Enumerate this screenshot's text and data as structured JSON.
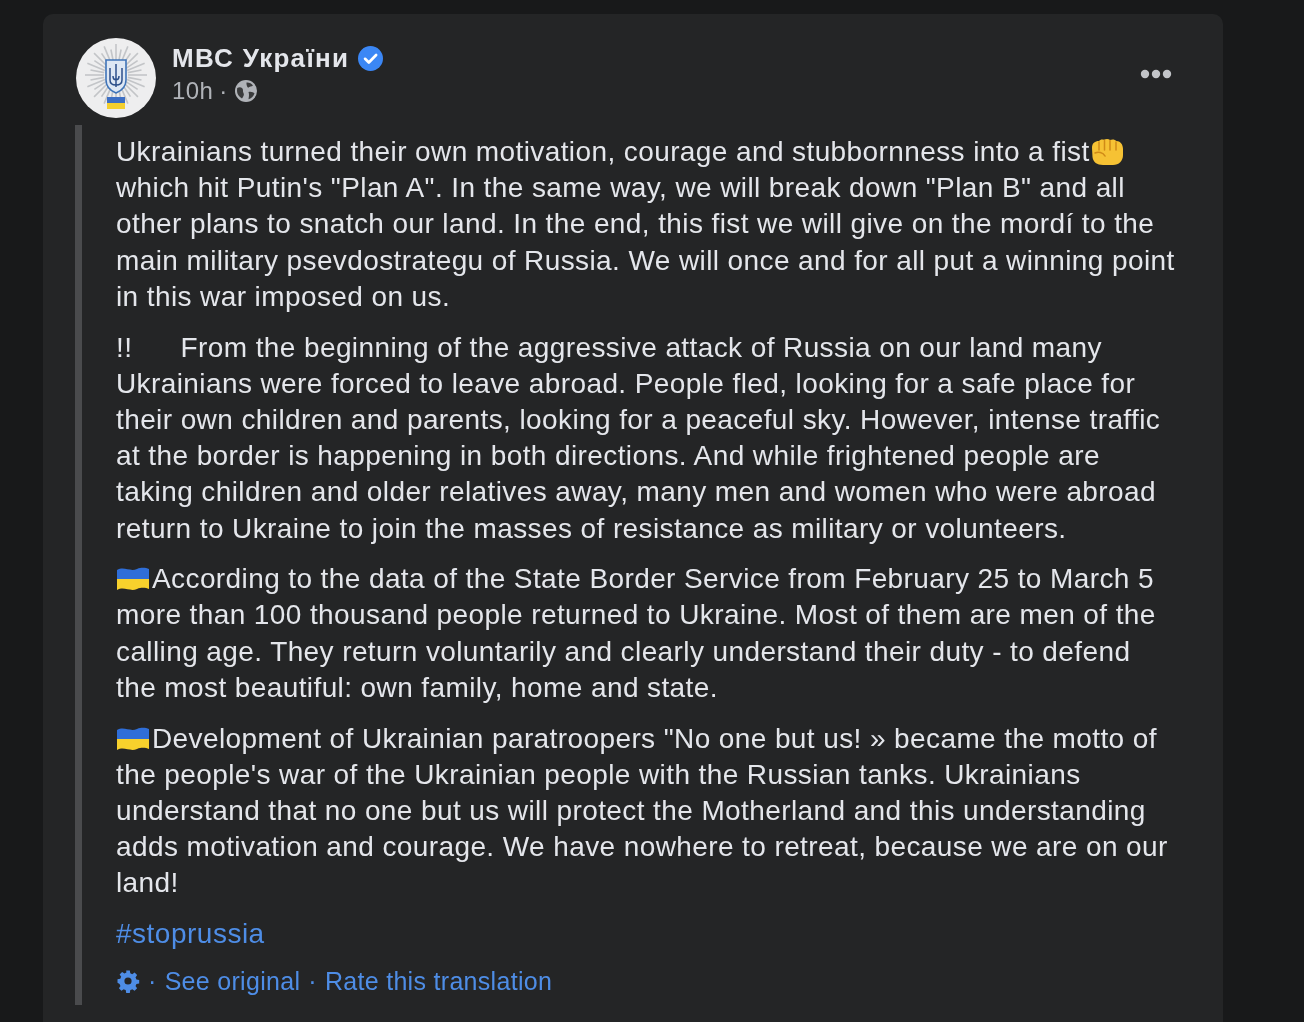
{
  "post": {
    "author": {
      "name": "МВС України",
      "verified": true
    },
    "meta": {
      "time": "10h",
      "separator": "·"
    }
  },
  "body": {
    "paragraphs": [
      {
        "runs": [
          {
            "kind": "text",
            "text": "Ukrainians turned their own motivation, courage and stubbornness into a fist"
          },
          {
            "kind": "fist"
          },
          {
            "kind": "text",
            "text": "which hit Putin's \"Plan A\". In the same way, we will break down \"Plan B\" and all other plans to snatch our land. In the end, this fist we will give on the mordí to the main military psevdostrategu of Russia. We will once and for all put a winning point in this war imposed on us."
          }
        ]
      },
      {
        "runs": [
          {
            "kind": "mark",
            "text": "!!"
          },
          {
            "kind": "text",
            "text": "From the beginning of the aggressive attack of Russia on our land many Ukrainians were forced to leave abroad. People fled, looking for a safe place for their own children and parents, looking for a peaceful sky. However, intense traffic at the border is happening in both directions. And while frightened people are taking children and older relatives away, many men and women who were abroad return to Ukraine to join the masses of resistance as military or volunteers."
          }
        ]
      },
      {
        "runs": [
          {
            "kind": "flag"
          },
          {
            "kind": "text",
            "text": "According to the data of the State Border Service from February 25 to March 5 more than 100 thousand people returned to Ukraine. Most of them are men of the calling age. They return voluntarily and clearly understand their duty - to defend the most beautiful: own family, home and state."
          }
        ]
      },
      {
        "runs": [
          {
            "kind": "flag"
          },
          {
            "kind": "text",
            "text": "Development of Ukrainian paratroopers \"No one but us! » became the motto of the people's war of the Ukrainian people with the Russian tanks. Ukrainians understand that no one but us will protect the Motherland and this understanding adds motivation and courage. We have nowhere to retreat, because we are on our land!"
          }
        ]
      }
    ],
    "hashtag": "#stoprussia"
  },
  "translation": {
    "links": [
      {
        "separator": "·",
        "text": "See original"
      },
      {
        "separator": "·",
        "text": "Rate this translation"
      }
    ]
  }
}
